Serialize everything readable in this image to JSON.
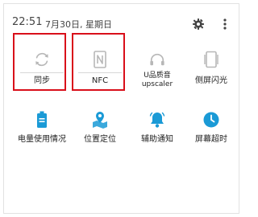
{
  "status_bar": {
    "time": "22:51",
    "date": "7月30日, 星期日",
    "icons": [
      "gear-icon",
      "menu-icon"
    ]
  },
  "quick_settings": {
    "row1": [
      {
        "label": "同步",
        "icon": "sync-icon",
        "active": false,
        "highlighted": true
      },
      {
        "label": "NFC",
        "icon": "nfc-icon",
        "active": false,
        "highlighted": true
      },
      {
        "label": "U品质音\nupscaler",
        "icon": "headphones-icon",
        "active": false,
        "highlighted": false
      },
      {
        "label": "侧屏闪光",
        "icon": "edge-flash-icon",
        "active": false,
        "highlighted": false
      }
    ],
    "row2": [
      {
        "label": "电量使用情况",
        "icon": "battery-icon"
      },
      {
        "label": "位置定位",
        "icon": "location-icon"
      },
      {
        "label": "辅助通知",
        "icon": "bell-icon"
      },
      {
        "label": "屏幕超时",
        "icon": "clock-icon"
      }
    ]
  },
  "colors": {
    "accent": "#1a9ad6",
    "highlight_border": "#d90f1a",
    "inactive_icon": "#b7b7b7"
  }
}
